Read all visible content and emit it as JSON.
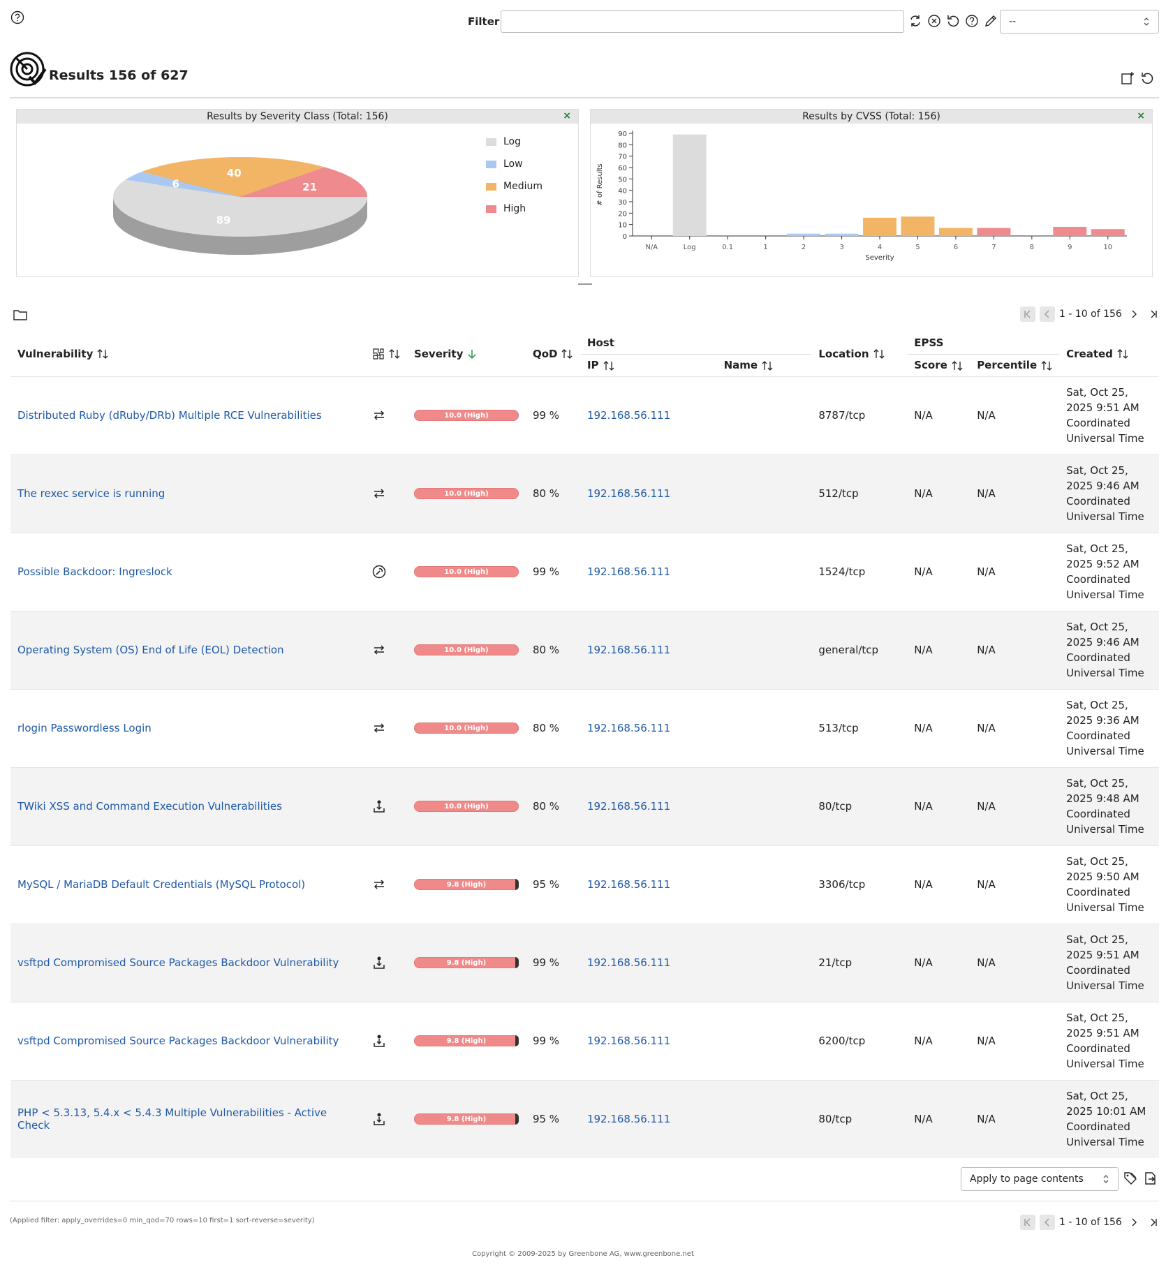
{
  "filter": {
    "label": "Filter",
    "value": "",
    "select_value": "--"
  },
  "title": "Results 156 of 627",
  "charts": {
    "severity_panel_title": "Results by Severity Class (Total: 156)",
    "cvss_panel_title": "Results by CVSS (Total: 156)",
    "close_symbol": "×"
  },
  "chart_data": [
    {
      "type": "pie",
      "title": "Results by Severity Class (Total: 156)",
      "categories": [
        "Log",
        "Low",
        "Medium",
        "High"
      ],
      "values": [
        89,
        6,
        40,
        21
      ],
      "colors": [
        "#dcdcdc",
        "#a9c9f3",
        "#f1b565",
        "#ef8a8e"
      ],
      "legend": "right"
    },
    {
      "type": "bar",
      "title": "Results by CVSS (Total: 156)",
      "xlabel": "Severity",
      "ylabel": "# of Results",
      "categories": [
        "N/A",
        "Log",
        "0.1",
        "1",
        "2",
        "3",
        "4",
        "5",
        "6",
        "7",
        "8",
        "9",
        "10"
      ],
      "values": [
        0,
        89,
        0,
        0,
        2,
        2,
        16,
        17,
        7,
        7,
        0,
        8,
        6
      ],
      "colors": [
        "#dcdcdc",
        "#dcdcdc",
        "#a9c9f3",
        "#a9c9f3",
        "#a9c9f3",
        "#a9c9f3",
        "#f1b565",
        "#f1b565",
        "#f1b565",
        "#ef8a8e",
        "#ef8a8e",
        "#ef8a8e",
        "#ef8a8e"
      ],
      "yticks": [
        0,
        10,
        20,
        30,
        40,
        50,
        60,
        70,
        80,
        90
      ],
      "ylim": [
        0,
        90
      ]
    }
  ],
  "pagination": {
    "text": "1 - 10 of 156"
  },
  "table": {
    "headers": {
      "vulnerability": "Vulnerability",
      "severity": "Severity",
      "qod": "QoD",
      "host": "Host",
      "ip": "IP",
      "name": "Name",
      "location": "Location",
      "epss": "EPSS",
      "score": "Score",
      "percentile": "Percentile",
      "created": "Created"
    },
    "rows": [
      {
        "vulnerability": "Distributed Ruby (dRuby/DRb) Multiple RCE Vulnerabilities",
        "solution_icon": "mitigation-icon",
        "severity": "10.0 (High)",
        "qod": "99 %",
        "ip": "192.168.56.111",
        "name": "",
        "location": "8787/tcp",
        "epss_score": "N/A",
        "epss_percentile": "N/A",
        "created": [
          "Sat, Oct 25,",
          "2025 9:51 AM",
          "Coordinated",
          "Universal Time"
        ]
      },
      {
        "vulnerability": "The rexec service is running",
        "solution_icon": "mitigation-icon",
        "severity": "10.0 (High)",
        "qod": "80 %",
        "ip": "192.168.56.111",
        "name": "",
        "location": "512/tcp",
        "epss_score": "N/A",
        "epss_percentile": "N/A",
        "created": [
          "Sat, Oct 25,",
          "2025 9:46 AM",
          "Coordinated",
          "Universal Time"
        ]
      },
      {
        "vulnerability": "Possible Backdoor: Ingreslock",
        "solution_icon": "workaround-icon",
        "severity": "10.0 (High)",
        "qod": "99 %",
        "ip": "192.168.56.111",
        "name": "",
        "location": "1524/tcp",
        "epss_score": "N/A",
        "epss_percentile": "N/A",
        "created": [
          "Sat, Oct 25,",
          "2025 9:52 AM",
          "Coordinated",
          "Universal Time"
        ]
      },
      {
        "vulnerability": "Operating System (OS) End of Life (EOL) Detection",
        "solution_icon": "mitigation-icon",
        "severity": "10.0 (High)",
        "qod": "80 %",
        "ip": "192.168.56.111",
        "name": "",
        "location": "general/tcp",
        "epss_score": "N/A",
        "epss_percentile": "N/A",
        "created": [
          "Sat, Oct 25,",
          "2025 9:46 AM",
          "Coordinated",
          "Universal Time"
        ]
      },
      {
        "vulnerability": "rlogin Passwordless Login",
        "solution_icon": "mitigation-icon",
        "severity": "10.0 (High)",
        "qod": "80 %",
        "ip": "192.168.56.111",
        "name": "",
        "location": "513/tcp",
        "epss_score": "N/A",
        "epss_percentile": "N/A",
        "created": [
          "Sat, Oct 25,",
          "2025 9:36 AM",
          "Coordinated",
          "Universal Time"
        ]
      },
      {
        "vulnerability": "TWiki XSS and Command Execution Vulnerabilities",
        "solution_icon": "vendorfix-icon",
        "severity": "10.0 (High)",
        "qod": "80 %",
        "ip": "192.168.56.111",
        "name": "",
        "location": "80/tcp",
        "epss_score": "N/A",
        "epss_percentile": "N/A",
        "created": [
          "Sat, Oct 25,",
          "2025 9:48 AM",
          "Coordinated",
          "Universal Time"
        ]
      },
      {
        "vulnerability": "MySQL / MariaDB Default Credentials (MySQL Protocol)",
        "solution_icon": "mitigation-icon",
        "severity": "9.8 (High)",
        "qod": "95 %",
        "ip": "192.168.56.111",
        "name": "",
        "location": "3306/tcp",
        "epss_score": "N/A",
        "epss_percentile": "N/A",
        "created": [
          "Sat, Oct 25,",
          "2025 9:50 AM",
          "Coordinated",
          "Universal Time"
        ]
      },
      {
        "vulnerability": "vsftpd Compromised Source Packages Backdoor Vulnerability",
        "solution_icon": "vendorfix-icon",
        "severity": "9.8 (High)",
        "qod": "99 %",
        "ip": "192.168.56.111",
        "name": "",
        "location": "21/tcp",
        "epss_score": "N/A",
        "epss_percentile": "N/A",
        "created": [
          "Sat, Oct 25,",
          "2025 9:51 AM",
          "Coordinated",
          "Universal Time"
        ]
      },
      {
        "vulnerability": "vsftpd Compromised Source Packages Backdoor Vulnerability",
        "solution_icon": "vendorfix-icon",
        "severity": "9.8 (High)",
        "qod": "99 %",
        "ip": "192.168.56.111",
        "name": "",
        "location": "6200/tcp",
        "epss_score": "N/A",
        "epss_percentile": "N/A",
        "created": [
          "Sat, Oct 25,",
          "2025 9:51 AM",
          "Coordinated",
          "Universal Time"
        ]
      },
      {
        "vulnerability": "PHP < 5.3.13, 5.4.x < 5.4.3 Multiple Vulnerabilities - Active Check",
        "solution_icon": "vendorfix-icon",
        "severity": "9.8 (High)",
        "qod": "95 %",
        "ip": "192.168.56.111",
        "name": "",
        "location": "80/tcp",
        "epss_score": "N/A",
        "epss_percentile": "N/A",
        "created": [
          "Sat, Oct 25,",
          "2025 10:01 AM",
          "Coordinated",
          "Universal Time"
        ]
      }
    ]
  },
  "bulk": {
    "select_value": "Apply to page contents"
  },
  "footer": {
    "applied_filter": "(Applied filter: apply_overrides=0 min_qod=70 rows=10 first=1 sort-reverse=severity)",
    "copyright": "Copyright © 2009-2025 by Greenbone AG, www.greenbone.net"
  }
}
